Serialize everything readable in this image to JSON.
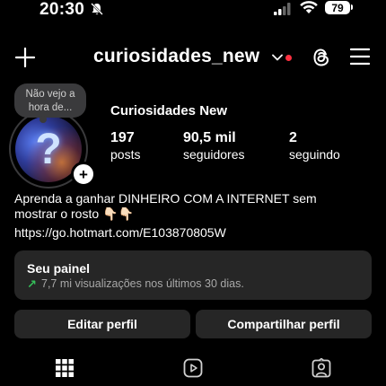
{
  "status_bar": {
    "time": "20:30",
    "battery": "79"
  },
  "header": {
    "username": "curiosidades_new"
  },
  "profile": {
    "note": "Não vejo a hora de...",
    "display_name": "Curiosidades New",
    "stats": [
      {
        "value": "197",
        "label": "posts"
      },
      {
        "value": "90,5 mil",
        "label": "seguidores"
      },
      {
        "value": "2",
        "label": "seguindo"
      }
    ],
    "bio_line1": "Aprenda a ganhar DINHEIRO COM A INTERNET sem",
    "bio_line2": "mostrar o rosto 👇🏻👇🏻",
    "bio_link": "https://go.hotmart.com/E103870805W"
  },
  "panel": {
    "title": "Seu painel",
    "subtitle": "7,7 mi visualizações nos últimos 30 dias."
  },
  "buttons": {
    "edit": "Editar perfil",
    "share": "Compartilhar perfil"
  },
  "colors": {
    "background": "#000000",
    "card": "#262626",
    "accent_green": "#35c15a",
    "notification": "#ff3040"
  },
  "icons": [
    "bell-slash-icon",
    "signal-icon",
    "wifi-icon",
    "plus-icon",
    "chevron-down-icon",
    "threads-icon",
    "menu-icon",
    "grid-icon",
    "reels-icon",
    "tagged-icon"
  ]
}
